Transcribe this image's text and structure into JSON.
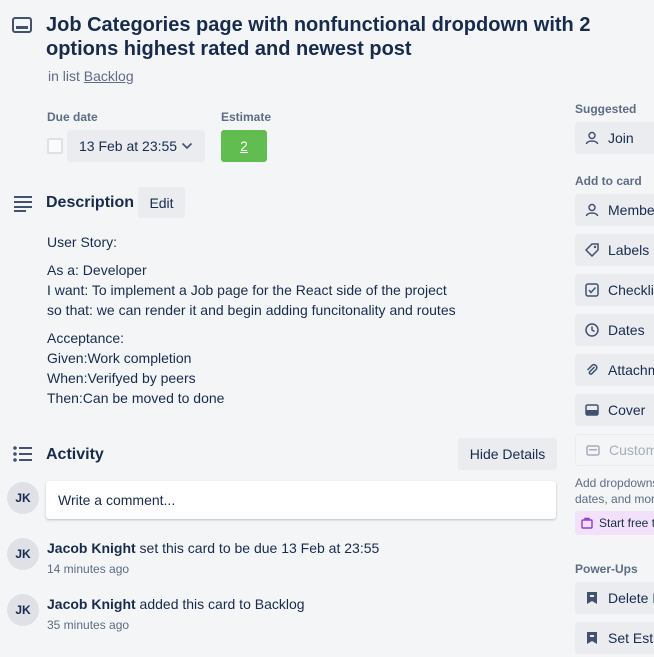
{
  "card": {
    "title": "Job Categories page with nonfunctional dropdown with 2 options highest rated and newest post",
    "in_list_prefix": "in list",
    "list_name": "Backlog"
  },
  "fields": {
    "due_label": "Due date",
    "due_value": "13 Feb at 23:55",
    "estimate_label": "Estimate",
    "estimate_value": "2"
  },
  "description": {
    "title": "Description",
    "edit_label": "Edit",
    "paragraphs": [
      [
        "User Story:"
      ],
      [
        "As a: Developer",
        "I want: To implement a Job page for the React side of the project",
        "so that: we can render it and begin adding funcitonality and routes"
      ],
      [
        "Acceptance:",
        "Given:Work completion",
        "When:Verifyed by peers",
        "Then:Can be moved to done"
      ]
    ]
  },
  "activity": {
    "title": "Activity",
    "hide_details_label": "Hide Details",
    "avatar_initials": "JK",
    "comment_placeholder": "Write a comment...",
    "items": [
      {
        "user": "Jacob Knight",
        "action": " set this card to be due 13 Feb at 23:55",
        "time": "14 minutes ago"
      },
      {
        "user": "Jacob Knight",
        "action": " added this card to Backlog",
        "time": "35 minutes ago"
      }
    ]
  },
  "sidebar": {
    "suggested_label": "Suggested",
    "join_label": "Join",
    "add_to_card_label": "Add to card",
    "buttons": [
      {
        "label": "Members",
        "icon": "person-icon"
      },
      {
        "label": "Labels",
        "icon": "tag-icon"
      },
      {
        "label": "Checklist",
        "icon": "checklist-icon"
      },
      {
        "label": "Dates",
        "icon": "clock-icon"
      },
      {
        "label": "Attachment",
        "icon": "paperclip-icon"
      },
      {
        "label": "Cover",
        "icon": "cover-icon"
      },
      {
        "label": "Custom Fields",
        "icon": "custom-fields-icon"
      }
    ],
    "note_line1": "Add dropdowns, text fields,",
    "note_line2": "dates, and more to your cards.",
    "trial_label": "Start free trial",
    "powerups_label": "Power-Ups",
    "powerups": [
      {
        "label": "Delete Estimate",
        "icon": "estimate-icon"
      },
      {
        "label": "Set Estimate",
        "icon": "estimate-icon"
      }
    ]
  },
  "colors": {
    "estimate_green": "#61bd4f",
    "trial_purple": "#f3e1fb",
    "text": "#172b4d",
    "muted": "#5e6c84"
  }
}
